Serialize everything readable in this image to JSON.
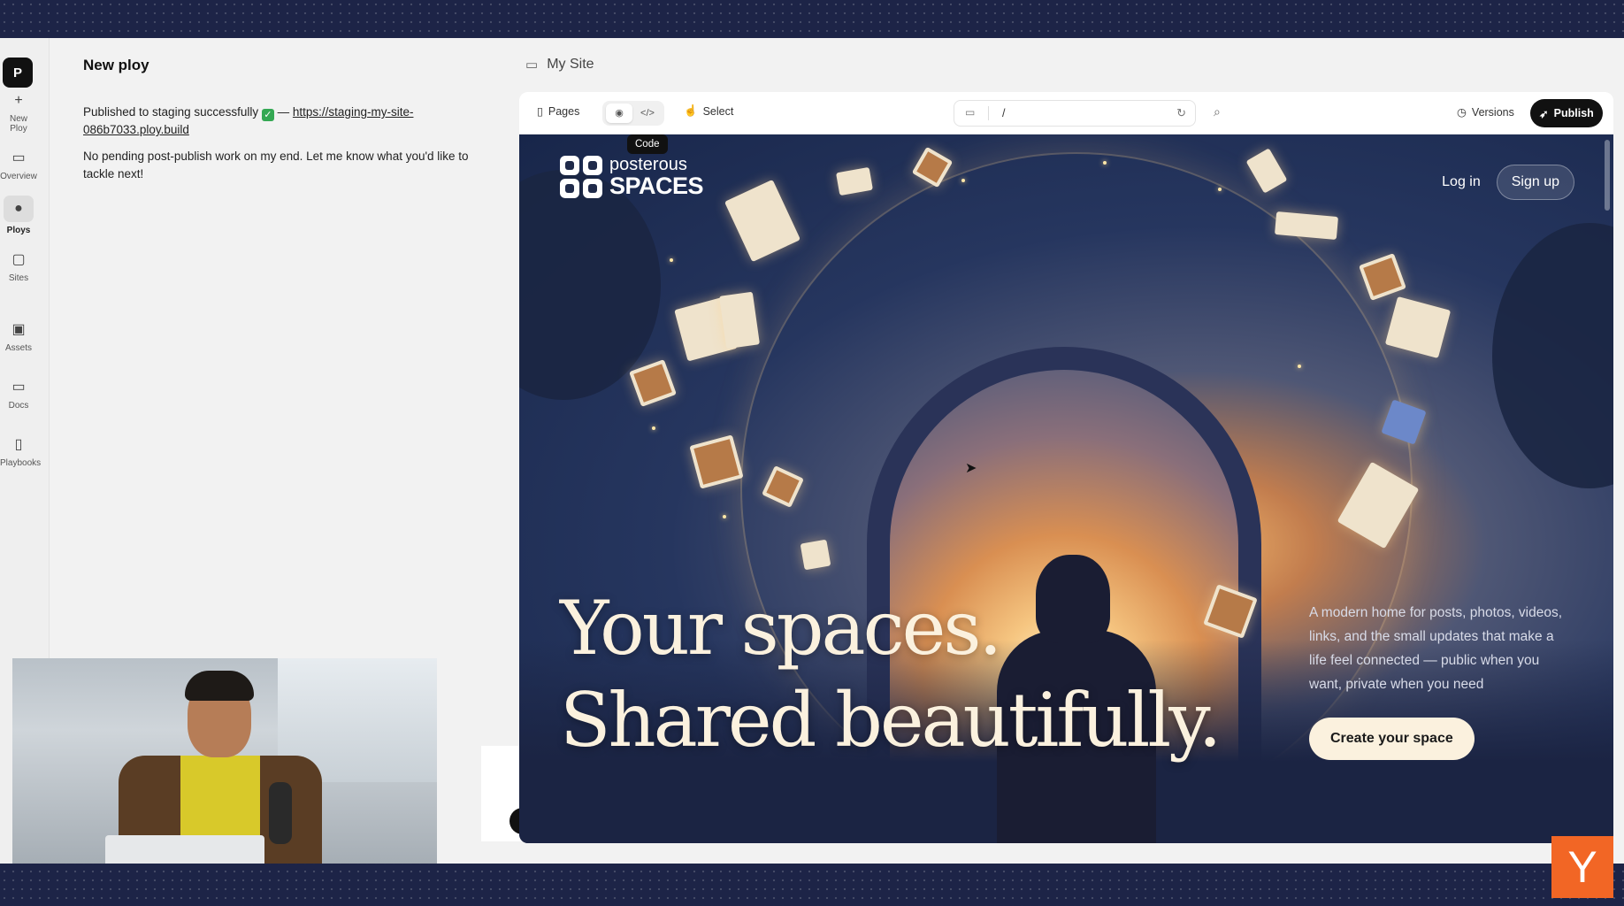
{
  "rail": {
    "logo": "P",
    "items": [
      {
        "label": "New Ploy",
        "icon": "plus-icon"
      },
      {
        "label": "Overview",
        "icon": "overview-icon"
      },
      {
        "label": "Ploys",
        "icon": "chat-bubble-icon"
      },
      {
        "label": "Sites",
        "icon": "browser-icon"
      },
      {
        "label": "Assets",
        "icon": "image-icon"
      },
      {
        "label": "Docs",
        "icon": "folder-icon"
      },
      {
        "label": "Playbooks",
        "icon": "book-icon"
      }
    ]
  },
  "chat": {
    "title": "New ploy",
    "message1_prefix": "Published to staging successfully",
    "message1_dash": " — ",
    "message1_link": "https://staging-my-site-086b7033.ploy.build",
    "message2": "No pending post-publish work on my end. Let me know what you'd like to tackle next!"
  },
  "workspace": {
    "site_name": "My Site",
    "toolbar": {
      "pages": "Pages",
      "select": "Select",
      "tooltip": "Code",
      "url_path": "/",
      "versions": "Versions",
      "publish": "Publish"
    }
  },
  "hero": {
    "logo_line1": "posterous",
    "logo_line2": "SPACES",
    "login": "Log in",
    "signup": "Sign up",
    "headline_line1": "Your spaces.",
    "headline_line2": "Shared beautifully.",
    "copy": "A modern home for posts, photos, videos, links, and the small updates that make a life feel connected — public when you want, private when you need",
    "cta": "Create your space"
  },
  "badge": {
    "letter": "Y",
    "color": "#f26625"
  }
}
